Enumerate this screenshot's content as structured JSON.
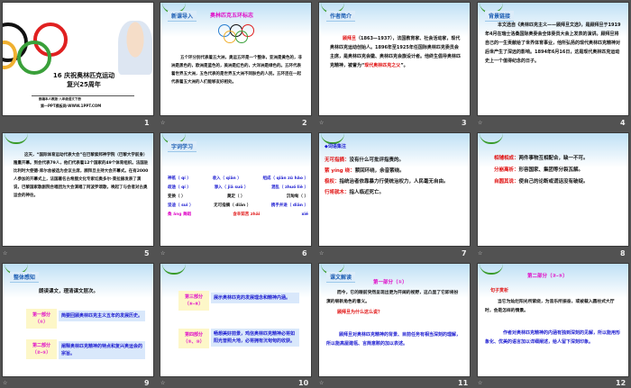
{
  "slides": [
    {
      "number": "1",
      "title1": "16 庆祝奥林匹克运动",
      "title2": "复兴25周年",
      "sub": "部编本人教版·八年级语文下册",
      "site": "第一PPT模板网-WWW.1PPT.COM"
    },
    {
      "number": "2",
      "tag": "新课导入",
      "heading": "奥林匹克五环标志",
      "body": "五个环分别代表着五大洲，奥运五环是一个整体，亚洲是黄色的，非洲是黑色的，欧洲是蓝色的，美洲是红色的，大洋洲是绿色的。五环代表着世界五大洲，五色代表的是世界五大洲不同肤色的人民。五环连在一起代表着五大洲的人们能够友好相处。"
    },
    {
      "number": "3",
      "tag": "作者简介",
      "name": "顾拜旦",
      "body": "（1863—1937），法国教育家、社会活动家，现代奥林匹克运动创始人。1896年至1925年任国际奥林匹克委员会主席，是奥林匹克会徽、奥林匹克会旗设计者。他终生倡导奥林匹克精神，被誉为“",
      "honor": "现代奥林匹克之父",
      "end": "”。"
    },
    {
      "number": "4",
      "tag": "背景链接",
      "body": "本文选自《奥林匹克主义——顾拜旦文选》，是顾拜旦于1919年4月在瑞士洛桑国际奥委会全体委员大会上发表的演讲。顾拜旦将自己的一生贡献给了世界体育事业，他所弘扬的现代奥林匹克精神对后世产生了深远的影响。1894年6月16日，这是现代奥林匹克运动史上一个值得纪念的日子。"
    },
    {
      "number": "5",
      "body": "这天，“国际体育运动代表大会”在巴黎索邦神学院（巴黎大学前身）隆重开幕。到会代表79人，他们代表着12个国家的49个体育组织。法国驻比利时大使德·库尔舍被选为会议主席，顾拜旦主持大会开幕式。在有2000人参加的开幕式上，法国著名古希腊文化专家切奥多尔·莱拉赫发表了演说，巴黎国家歌剧院合唱团为大会演唱了阿波罗颂歌，唤起了与会者对古奥运会的神往。"
    },
    {
      "number": "6",
      "tag": "字词学习",
      "rows": [
        [
          "神祇（ qí ）",
          "收入（ qiān ）",
          "组成（ qiān zǔ hǎo ）"
        ],
        [
          "歧途（ qí ）",
          "渗入（ jiā suō ）",
          "混乱（ zhuó liè ）"
        ],
        [
          "变换（    ）",
          "奠定（    ）",
          "沉甸甸（    ）"
        ],
        [
          "坚迪（ suì ）",
          "无可指摘（ diān ）",
          "携手并进（ diān ）"
        ],
        [
          "桑 ǎng 舞蹈",
          "含辛茹苦 zhāi",
          "xié"
        ]
      ]
    },
    {
      "number": "7",
      "tag": "词语集注",
      "items": [
        {
          "term": "无可指摘：",
          "def": "没有什么可批评指责的。"
        },
        {
          "term": "萦 yíng 绕：",
          "def": "萦回环绕，余音萦绕。"
        },
        {
          "term": "极权：",
          "def": "指统治者依靠暴力行使统治权力，人民毫无自由。"
        },
        {
          "term": "行将就木：",
          "def": "指人临近死亡。"
        }
      ]
    },
    {
      "number": "8",
      "items": [
        {
          "term": "相辅相成：",
          "def": "两件事物互相配合，缺一不可。"
        },
        {
          "term": "分崩离析：",
          "def": "形容国家、集团等分裂瓦解。"
        },
        {
          "term": "自圆其说：",
          "def": "使自己的论断或谎话没有破绽。"
        }
      ]
    },
    {
      "number": "9",
      "tag": "整体感知",
      "heading": "朗读课文，理清课文层次。",
      "parts": [
        {
          "label": "第一部分（①）",
          "desc": "简要回顾奥林匹克主义五年的发展历史。"
        },
        {
          "label": "第二部分（②-⑤）",
          "desc": "阐释奥林匹克精神的特点和复兴奥运会的宗旨。"
        }
      ]
    },
    {
      "number": "10",
      "parts": [
        {
          "label": "第三部分（⑥-⑧）",
          "desc": "展示奥林匹克的发展理念和精神内涵。"
        },
        {
          "label": "第四部分（⑨、⑩）",
          "desc": "畅想美好前景，鸡信奥林匹克精神必将如阳光普照大地，必将拥有沉甸甸的收获。"
        }
      ]
    },
    {
      "number": "11",
      "tag": "课文解读",
      "heading": "第一部分（①）",
      "quote": "而今，它的眼前突然呈现出更为开阔的视野，这凸显了它即将扮演的崭新角色的意义。",
      "question": "顾拜旦为什么这么说？",
      "answer": "顾拜旦对奥林匹克精神的背景、目前任务有相当深刻的理解，所以能高屋建瓴、言简意赅的加以表述。"
    },
    {
      "number": "12",
      "heading": "第二部分（②-⑤）",
      "tag": "句子赏析",
      "quote": "当它为灿烂阳光所萦绕，为音乐所振奋，或被载入圆柱式大厅时，会是怎样的情景。",
      "answer": "作者对奥林匹克精神的内涵有独到深刻的见解，所以能用形象化、优美的语言加以详细阐述，给人留下深刻印象。"
    }
  ],
  "colors": {
    "background": "#525252",
    "red": "#e01010",
    "blue": "#1a1ad0",
    "magenta": "#e010c8"
  }
}
